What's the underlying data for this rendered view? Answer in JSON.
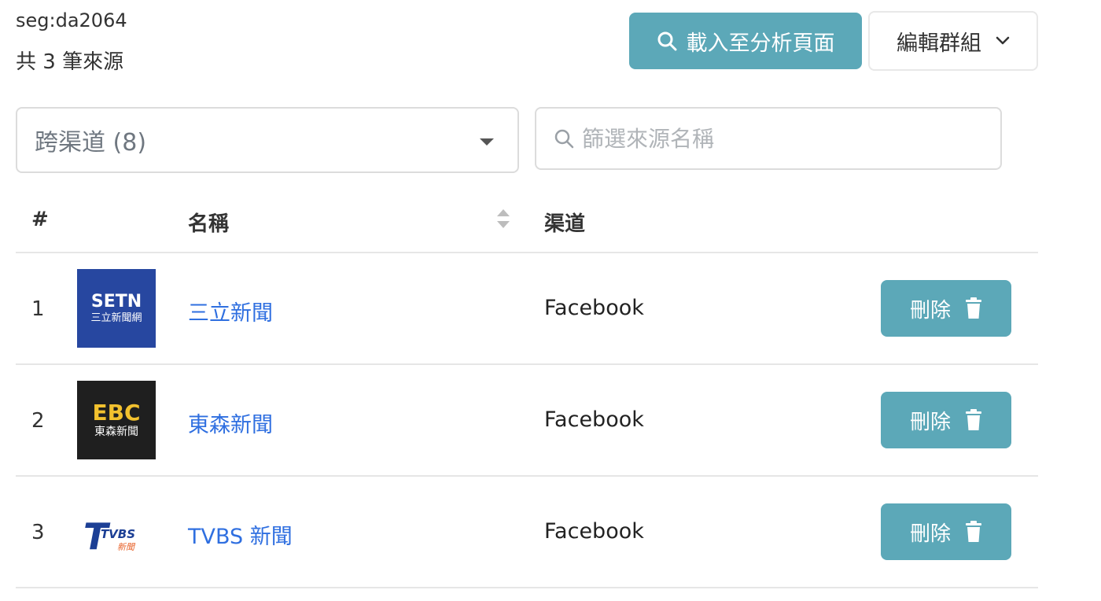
{
  "segment": {
    "id": "seg:da2064",
    "count_text": "共 3 筆來源"
  },
  "toolbar": {
    "load_label": "載入至分析頁面",
    "edit_group_label": "編輯群組"
  },
  "filter": {
    "channel_selected": "跨渠道 (8)",
    "search_placeholder": "篩選來源名稱",
    "search_value": ""
  },
  "table": {
    "columns": {
      "index": "#",
      "name": "名稱",
      "channel": "渠道"
    },
    "rows": [
      {
        "index": "1",
        "name": "三立新聞",
        "channel": "Facebook",
        "logo": "setn-logo",
        "logo_text": [
          "SETN",
          "三立新聞網"
        ],
        "delete_label": "刪除"
      },
      {
        "index": "2",
        "name": "東森新聞",
        "channel": "Facebook",
        "logo": "ebc-logo",
        "logo_text": [
          "EBC",
          "東森新聞"
        ],
        "delete_label": "刪除"
      },
      {
        "index": "3",
        "name": "TVBS 新聞",
        "channel": "Facebook",
        "logo": "tvbs-logo",
        "logo_text": [
          "TVBS",
          "新聞"
        ],
        "delete_label": "刪除"
      }
    ]
  },
  "colors": {
    "accent": "#5ca8b8",
    "link": "#2f6fe0",
    "setn_bg": "#2747a0",
    "ebc_bg": "#1f1f1f",
    "ebc_gold": "#f2c12e",
    "tvbs_blue": "#1c3f95",
    "tvbs_orange": "#e8632b"
  }
}
